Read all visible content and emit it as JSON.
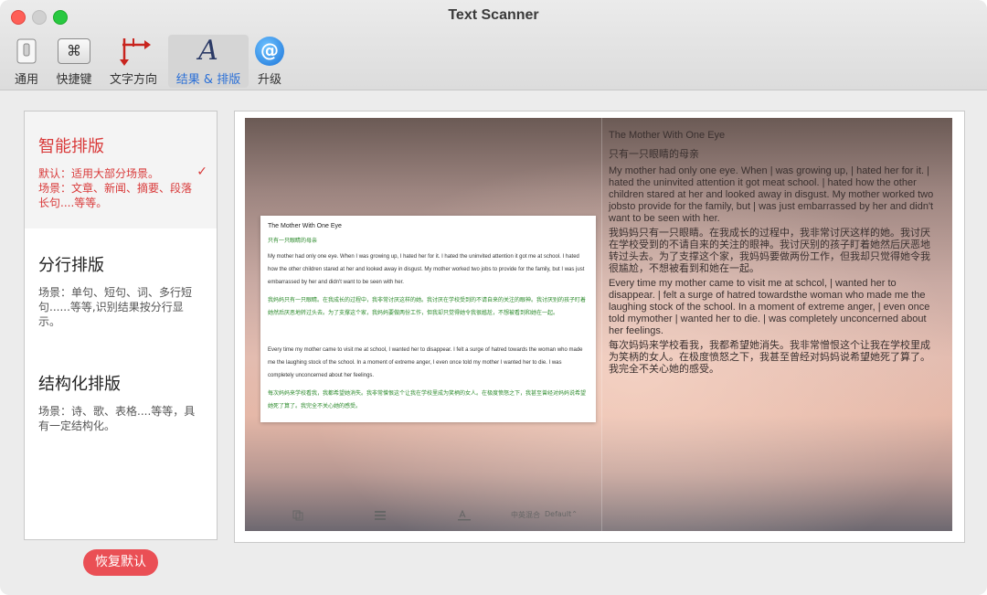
{
  "window": {
    "title": "Text Scanner"
  },
  "toolbar": {
    "items": [
      {
        "label": "通用"
      },
      {
        "label": "快捷键"
      },
      {
        "label": "文字方向"
      },
      {
        "label": "结果 & 排版"
      },
      {
        "label": "升级"
      }
    ],
    "shortcut_glyph": "⌘",
    "results_glyph": "A",
    "upgrade_glyph": "@"
  },
  "sidebar": {
    "options": [
      {
        "title": "智能排版",
        "desc": "默认：适用大部分场景。\n场景：文章、新闻、摘要、段落长句....等等。",
        "selected": true
      },
      {
        "title": "分行排版",
        "desc": "场景：单句、短句、词、多行短句......等等,识别结果按分行显示。",
        "selected": false
      },
      {
        "title": "结构化排版",
        "desc": "场景：诗、歌、表格....等等，具有一定结构化。",
        "selected": false
      }
    ],
    "checkmark": "✓"
  },
  "reset_button": "恢复默认",
  "preview": {
    "card": {
      "title": "The Mother With One Eye",
      "subtitle": "只有一只眼睛的母亲",
      "p1_en": "My mother had only one eye. When I was growing up, I hated her for it. I hated the uninvited attention it got me at school. I hated how the other children stared at her and looked away in disgust. My mother worked two jobs to provide for the family, but I was just embarrassed by her and didn't want to be seen with her.",
      "p1_zh": "我妈妈只有一只眼睛。在我成长的过程中，我非常讨厌这样的她。我讨厌在学校受到的不请自来的关注的眼神。我讨厌别的孩子盯着她然后厌恶地转过头去。为了支撑这个家，我妈妈要做两份工作，但我却只觉得她令我很尴尬，不想被看到和她在一起。",
      "p2_en": "Every time my mother came to visit me at school, I wanted her to disappear. I felt a surge of hatred towards the woman who made me the laughing stock of the school. In a moment of extreme anger, I even once told my mother I wanted her to die. I was completely unconcerned about her feelings.",
      "p2_zh": "每次妈妈来学校看我，我都希望她消失。我非常憎恨这个让我在学校里成为笑柄的女人。在极度愤怒之下，我甚至曾经对妈妈说希望她死了算了。我完全不关心她的感受。"
    },
    "bottom_controls": {
      "lang": "中英混合",
      "font": "Default"
    },
    "result": {
      "title": "The Mother With One Eye",
      "subtitle": "只有一只眼睛的母亲",
      "p1_en": "My mother had only one eye. When | was growing up, | hated her for it. | hated the uninvited attention it got meat school. | hated how the other children stared at her and looked away in disgust. My mother worked two jobsto provide for the family, but | was just embarrassed by her and didn't want to be seen with her.",
      "p1_zh": "我妈妈只有一只眼睛。在我成长的过程中，我非常讨厌这样的她。我讨厌在学校受到的不请自来的关注的眼神。我讨厌别的孩子盯着她然后厌恶地转过头去。为了支撑这个家，我妈妈要做两份工作，但我却只觉得她令我很尴尬，不想被看到和她在一起。",
      "p2_en": "Every time my mother came to visit me at schcol, | wanted her to disappear. | felt a surge of hatred towardsthe woman who made me the laughing stock of the school. In a moment of extreme anger, | even once told mymother | wanted her to die. | was completely unconcerned about her feelings.",
      "p2_zh": "每次妈妈来学校看我，我都希望她消失。我非常憎恨这个让我在学校里成为笑柄的女人。在极度愤怒之下，我甚至曾经对妈妈说希望她死了算了。我完全不关心她的感受。"
    }
  }
}
